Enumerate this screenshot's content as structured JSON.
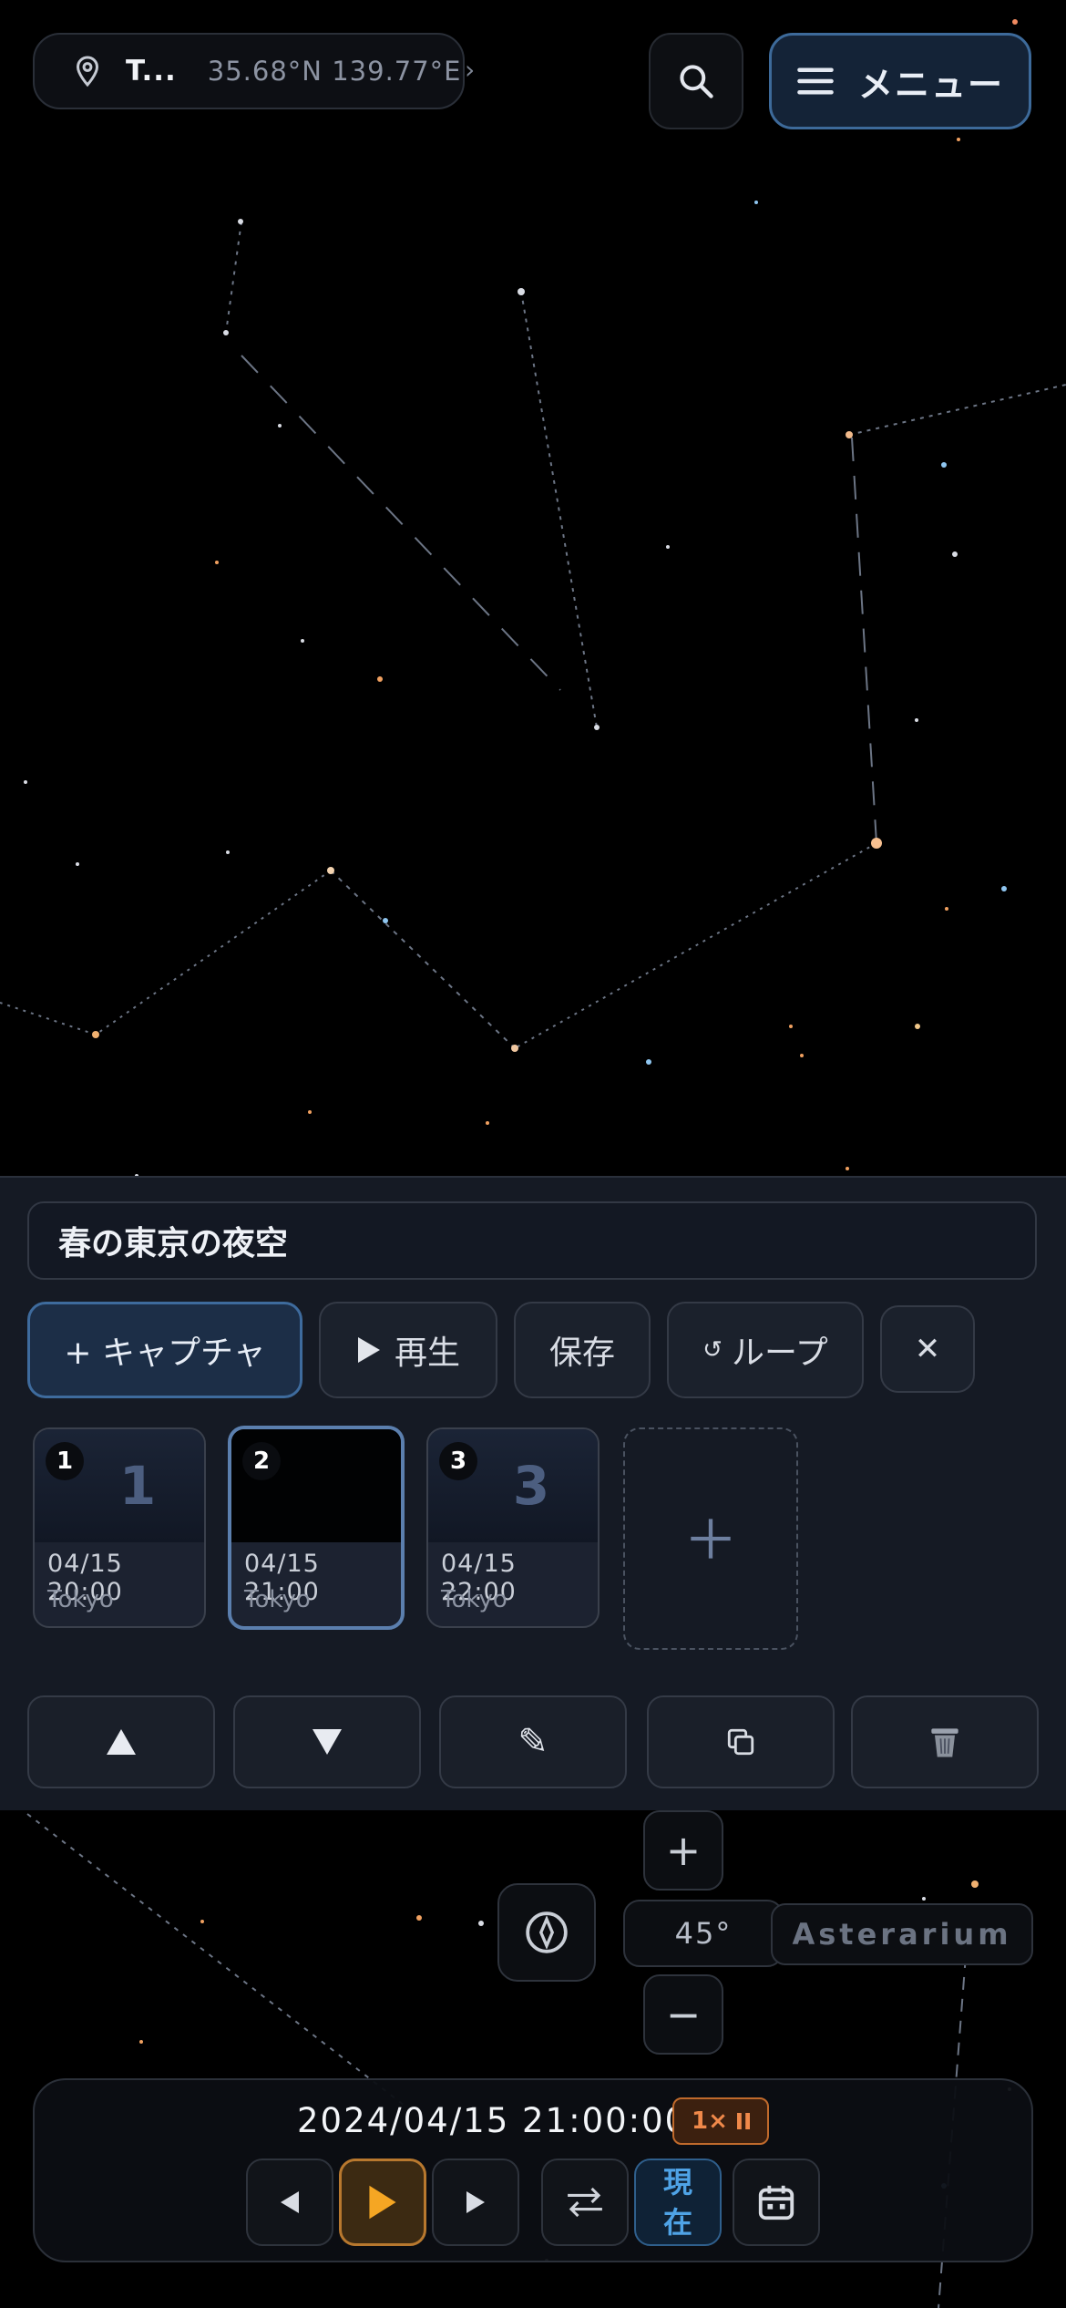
{
  "header": {
    "location_name": "T...",
    "location_coords": "35.68°N 139.77°E",
    "menu_label": "メニュー"
  },
  "panel": {
    "title_value": "春の東京の夜空",
    "toolbar": {
      "capture_label": "+ キャプチャ",
      "play_label": "再生",
      "save_label": "保存",
      "loop_label": "ループ",
      "close_label": "✕"
    },
    "frames": [
      {
        "index": "1",
        "big_number": "1",
        "datetime": "04/15 20:00",
        "location": "Tokyo",
        "selected": false
      },
      {
        "index": "2",
        "big_number": "",
        "datetime": "04/15 21:00",
        "location": "Tokyo",
        "selected": true
      },
      {
        "index": "3",
        "big_number": "3",
        "datetime": "04/15 22:00",
        "location": "Tokyo",
        "selected": false
      }
    ],
    "add_frame_icon": "plus-icon",
    "actions": [
      "up-triangle-icon",
      "down-triangle-icon",
      "pencil-icon",
      "duplicate-icon",
      "trash-icon"
    ]
  },
  "view_controls": {
    "zoom_in": "+",
    "zoom_out": "−",
    "fov": "45°",
    "mode_label": "Asterarium",
    "compass_icon": "compass-icon"
  },
  "timebar": {
    "datetime": "2024/04/15 21:00:00",
    "speed": "1×",
    "now_label_line1": "現",
    "now_label_line2": "在"
  },
  "colors": {
    "accent_blue": "#3e6b9d",
    "accent_orange": "#f0894a",
    "play_orange": "#f5a623",
    "background": "#000000",
    "panel": "#161b25"
  }
}
